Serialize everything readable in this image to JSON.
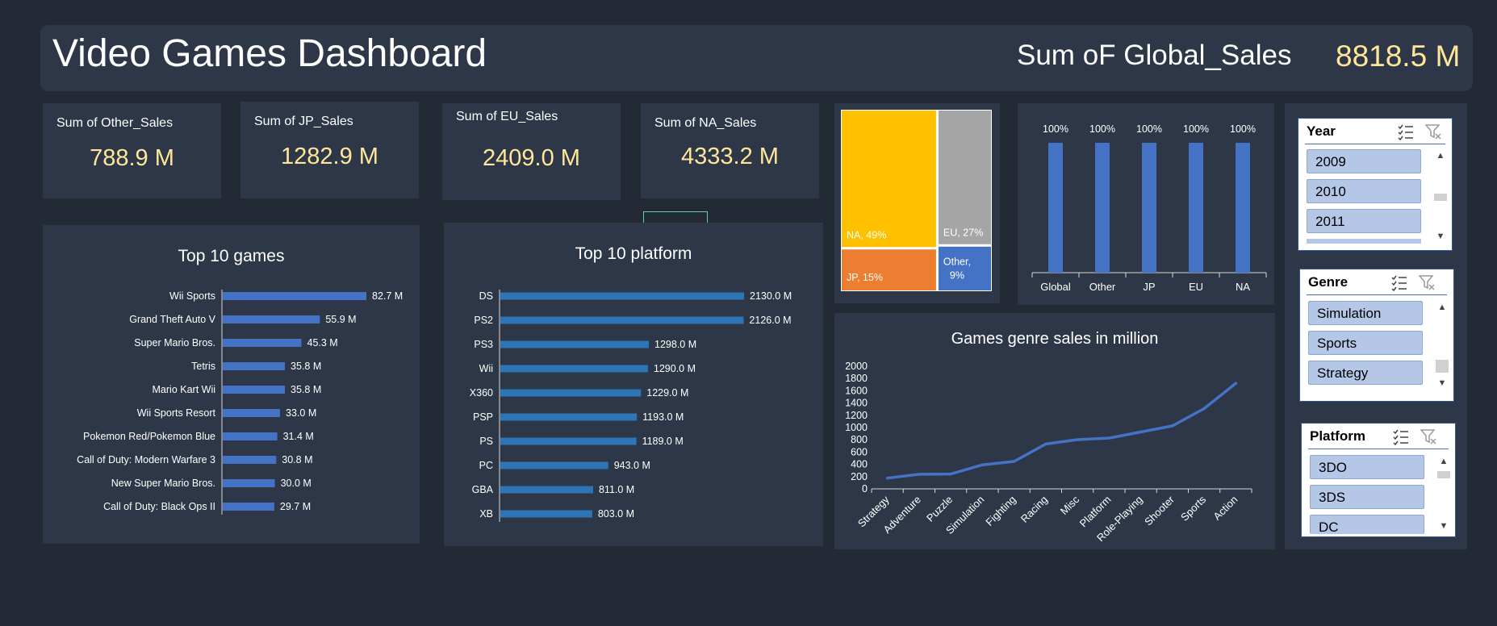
{
  "header": {
    "title": "Video Games Dashboard",
    "global_label": "Sum oF Global_Sales",
    "global_value": "8818.5 M"
  },
  "kpis": [
    {
      "label": "Sum of Other_Sales",
      "value": "788.9 M"
    },
    {
      "label": "Sum of JP_Sales",
      "value": "1282.9 M"
    },
    {
      "label": "Sum of EU_Sales",
      "value": "2409.0 M"
    },
    {
      "label": "Sum of NA_Sales",
      "value": "4333.2 M"
    }
  ],
  "colors": {
    "background": "#232a35",
    "panel": "#2d3748",
    "accent_value": "#ffe699",
    "bar_blue": "#4472c4",
    "platform_blue": "#2e75b6",
    "treemap_na": "#ffc000",
    "treemap_eu": "#a5a5a5",
    "treemap_jp": "#ed7d31",
    "treemap_other": "#4472c4"
  },
  "chart_data": [
    {
      "id": "top-games",
      "type": "bar",
      "orientation": "horizontal",
      "title": "Top 10 games",
      "categories": [
        "Wii Sports",
        "Grand Theft Auto V",
        "Super Mario Bros.",
        "Tetris",
        "Mario Kart Wii",
        "Wii Sports Resort",
        "Pokemon Red/Pokemon Blue",
        "Call of Duty: Modern Warfare 3",
        "New Super Mario Bros.",
        "Call of Duty: Black Ops II"
      ],
      "values": [
        82.7,
        55.9,
        45.3,
        35.8,
        35.8,
        33.0,
        31.4,
        30.8,
        30.0,
        29.7
      ],
      "labels": [
        "82.7 M",
        "55.9 M",
        "45.3 M",
        "35.8 M",
        "35.8 M",
        "33.0 M",
        "31.4 M",
        "30.8 M",
        "30.0 M",
        "29.7 M"
      ]
    },
    {
      "id": "top-platforms",
      "type": "bar",
      "orientation": "horizontal",
      "title": "Top 10 platform",
      "categories": [
        "DS",
        "PS2",
        "PS3",
        "Wii",
        "X360",
        "PSP",
        "PS",
        "PC",
        "GBA",
        "XB"
      ],
      "values": [
        2130.0,
        2126.0,
        1298.0,
        1290.0,
        1229.0,
        1193.0,
        1189.0,
        943.0,
        811.0,
        803.0
      ],
      "labels": [
        "2130.0 M",
        "2126.0 M",
        "1298.0 M",
        "1290.0 M",
        "1229.0 M",
        "1193.0 M",
        "1189.0 M",
        "943.0 M",
        "811.0 M",
        "803.0 M"
      ]
    },
    {
      "id": "region-treemap",
      "type": "treemap",
      "items": [
        {
          "label": "NA, 49%",
          "share": 49
        },
        {
          "label": "EU, 27%",
          "share": 27
        },
        {
          "label": "JP, 15%",
          "share": 15
        },
        {
          "label": "Other, 9%",
          "label_lines": [
            "Other,",
            "9%"
          ],
          "share": 9
        }
      ]
    },
    {
      "id": "region-percent",
      "type": "bar",
      "categories": [
        "Global",
        "Other",
        "JP",
        "EU",
        "NA"
      ],
      "values": [
        100,
        100,
        100,
        100,
        100
      ],
      "labels": [
        "100%",
        "100%",
        "100%",
        "100%",
        "100%"
      ],
      "ylim": [
        0,
        100
      ]
    },
    {
      "id": "genre-sales",
      "type": "line",
      "title": "Games genre sales in million",
      "categories": [
        "Strategy",
        "Adventure",
        "Puzzle",
        "Simulation",
        "Fighting",
        "Racing",
        "Misc",
        "Platform",
        "Role-Playing",
        "Shooter",
        "Sports",
        "Action"
      ],
      "values": [
        175,
        238,
        242,
        392,
        448,
        732,
        803,
        829,
        927,
        1027,
        1309,
        1722
      ],
      "y_ticks": [
        0,
        200,
        400,
        600,
        800,
        1000,
        1200,
        1400,
        1600,
        1800,
        2000
      ],
      "ylim": [
        0,
        2000
      ],
      "grid": false
    }
  ],
  "slicers": [
    {
      "title": "Year",
      "items": [
        "2009",
        "2010",
        "2011"
      ]
    },
    {
      "title": "Genre",
      "items": [
        "Simulation",
        "Sports",
        "Strategy"
      ]
    },
    {
      "title": "Platform",
      "items": [
        "3DO",
        "3DS",
        "DC"
      ]
    }
  ]
}
